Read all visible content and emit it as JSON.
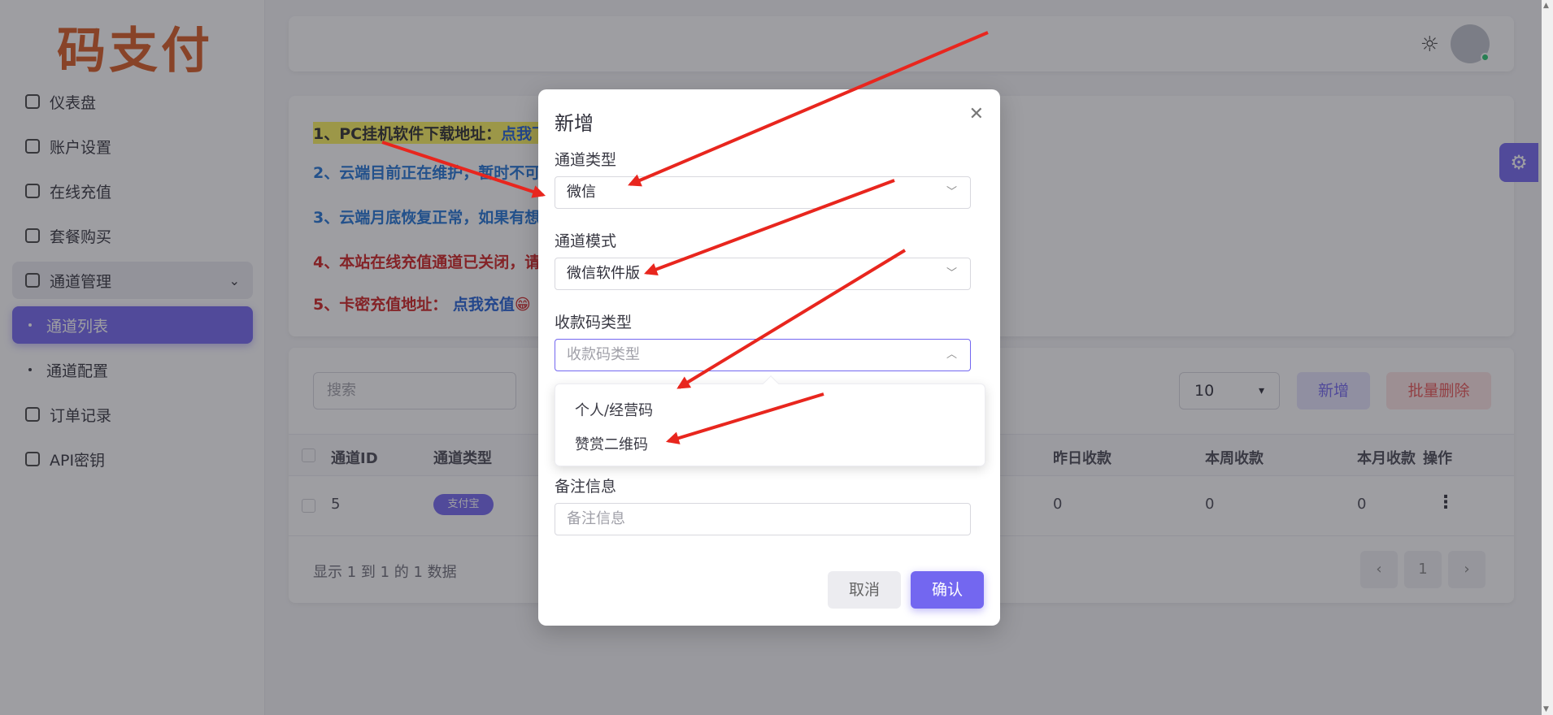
{
  "logo": "码支付",
  "sidebar": {
    "items": [
      {
        "label": "仪表盘"
      },
      {
        "label": "账户设置"
      },
      {
        "label": "在线充值"
      },
      {
        "label": "套餐购买"
      },
      {
        "label": "通道管理"
      },
      {
        "label": "通道列表"
      },
      {
        "label": "通道配置"
      },
      {
        "label": "订单记录"
      },
      {
        "label": "API密钥"
      }
    ]
  },
  "notices": [
    {
      "text": "1、PC挂机软件下载地址：",
      "link": "点我下"
    },
    {
      "text": "2、云端目前正在维护，暂时不可"
    },
    {
      "text": "3、云端月底恢复正常，如果有想"
    },
    {
      "text": "4、本站在线充值通道已关闭，请"
    },
    {
      "text": "5、卡密充值地址：",
      "link": "点我充值",
      "emoji": "😁"
    }
  ],
  "toolbar": {
    "search_placeholder": "搜索",
    "page_size": "10",
    "add_label": "新增",
    "batch_delete_label": "批量删除"
  },
  "table": {
    "headers": [
      "通道ID",
      "通道类型",
      "昨日收款",
      "本周收款",
      "本月收款",
      "操作"
    ],
    "rows": [
      {
        "id": "5",
        "type": "支付宝",
        "yesterday": "0",
        "week": "0",
        "month": "0"
      }
    ],
    "footer": "显示 1 到 1 的 1 数据",
    "page": "1"
  },
  "modal": {
    "title": "新增",
    "fields": [
      {
        "label": "通道类型",
        "value": "微信"
      },
      {
        "label": "通道模式",
        "value": "微信软件版"
      },
      {
        "label": "收款码类型",
        "placeholder": "收款码类型"
      },
      {
        "label": "备注信息",
        "placeholder": "备注信息"
      }
    ],
    "options": [
      "个人/经营码",
      "赞赏二维码"
    ],
    "cancel": "取消",
    "confirm": "确认"
  },
  "colors": {
    "primary": "#7367f0",
    "logo": "#d85a22",
    "danger": "#ea5455",
    "annotation": "#e8261e"
  }
}
